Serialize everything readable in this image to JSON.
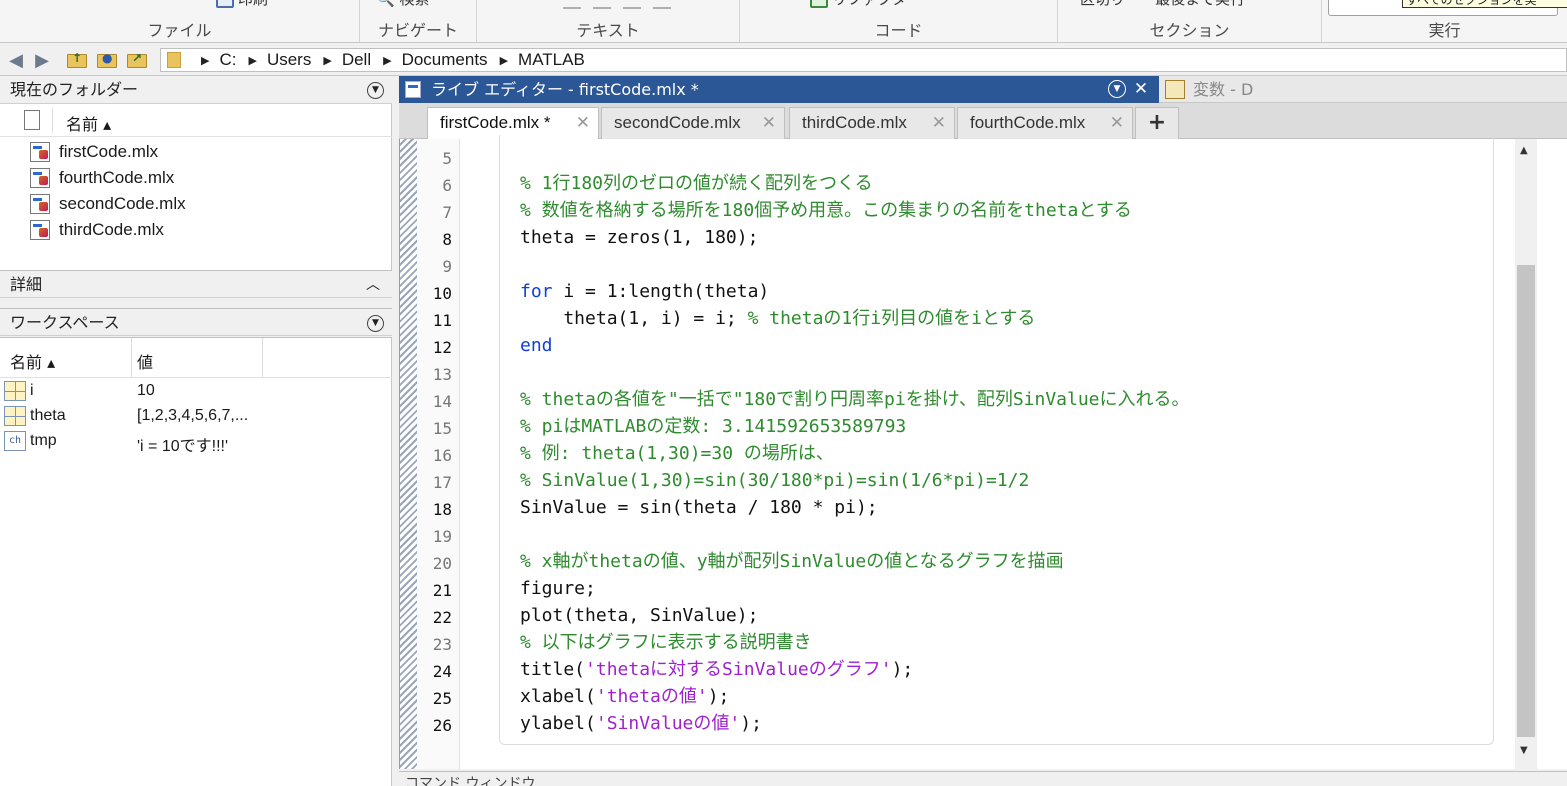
{
  "ribbon": {
    "sections": [
      {
        "caption": "ファイル",
        "cutoff": "印刷"
      },
      {
        "caption": "ナビゲート",
        "cutoff": "検索"
      },
      {
        "caption": "テキスト",
        "cutoff": ""
      },
      {
        "caption": "コード",
        "cutoff": "リファクター"
      },
      {
        "caption": "セクション",
        "cutoff": "区切り　　最後まで実行"
      },
      {
        "caption": "実行",
        "cutoff": ""
      }
    ],
    "tooltip": "すべてのセクションを実"
  },
  "address": {
    "segments": [
      "C:",
      "Users",
      "Dell",
      "Documents",
      "MATLAB"
    ]
  },
  "current_folder": {
    "title": "現在のフォルダー",
    "column_name": "名前 ▴",
    "files": [
      "firstCode.mlx",
      "fourthCode.mlx",
      "secondCode.mlx",
      "thirdCode.mlx"
    ]
  },
  "details": {
    "title": "詳細"
  },
  "workspace": {
    "title": "ワークスペース",
    "columns": [
      "名前 ▴",
      "値"
    ],
    "variables": [
      {
        "name": "i",
        "value": "10",
        "icon": "grid-icon"
      },
      {
        "name": "theta",
        "value": "[1,2,3,4,5,6,7,...",
        "icon": "grid-icon"
      },
      {
        "name": "tmp",
        "value": "'i = 10です!!!'",
        "icon": "char-icon"
      }
    ]
  },
  "editor": {
    "title": "ライブ エディター - firstCode.mlx *",
    "vars_title": "変数 - D",
    "tabs": [
      "firstCode.mlx *",
      "secondCode.mlx",
      "thirdCode.mlx",
      "fourthCode.mlx"
    ],
    "active_tab": 0,
    "line_numbers": [
      "5",
      "6",
      "7",
      "8",
      "9",
      "10",
      "11",
      "12",
      "13",
      "14",
      "15",
      "16",
      "17",
      "18",
      "19",
      "20",
      "21",
      "22",
      "23",
      "24",
      "25",
      "26"
    ],
    "lines": {
      "l6": "% 1行180列のゼロの値が続く配列をつくる",
      "l7": "% 数値を格納する場所を180個予め用意。この集まりの名前をthetaとする",
      "l8": "theta = zeros(1, 180);",
      "l10_kw": "for",
      "l10_rest": " i = 1:length(theta)",
      "l11_code": "    theta(1, i) = i; ",
      "l11_cm": "% thetaの1行i列目の値をiとする",
      "l12": "end",
      "l14": "% thetaの各値を\"一括で\"180で割り円周率piを掛け、配列SinValueに入れる。",
      "l15": "% piはMATLABの定数: 3.141592653589793",
      "l16": "% 例: theta(1,30)=30 の場所は、",
      "l17": "% SinValue(1,30)=sin(30/180*pi)=sin(1/6*pi)=1/2",
      "l18": "SinValue = sin(theta / 180 * pi);",
      "l20": "% x軸がthetaの値、y軸が配列SinValueの値となるグラフを描画",
      "l21": "figure;",
      "l22": "plot(theta, SinValue);",
      "l23": "% 以下はグラフに表示する説明書き",
      "l24_a": "title(",
      "l24_s": "'thetaに対するSinValueのグラフ'",
      "l24_b": ");",
      "l25_a": "xlabel(",
      "l25_s": "'thetaの値'",
      "l25_b": ");",
      "l26_a": "ylabel(",
      "l26_s": "'SinValueの値'",
      "l26_b": ");"
    }
  },
  "command_window": {
    "title": "コマンド ウィンドウ"
  },
  "colors": {
    "title_bar": "#2b5797",
    "comment": "#2e8b2e",
    "keyword": "#0e3edb",
    "string": "#a020d0"
  }
}
